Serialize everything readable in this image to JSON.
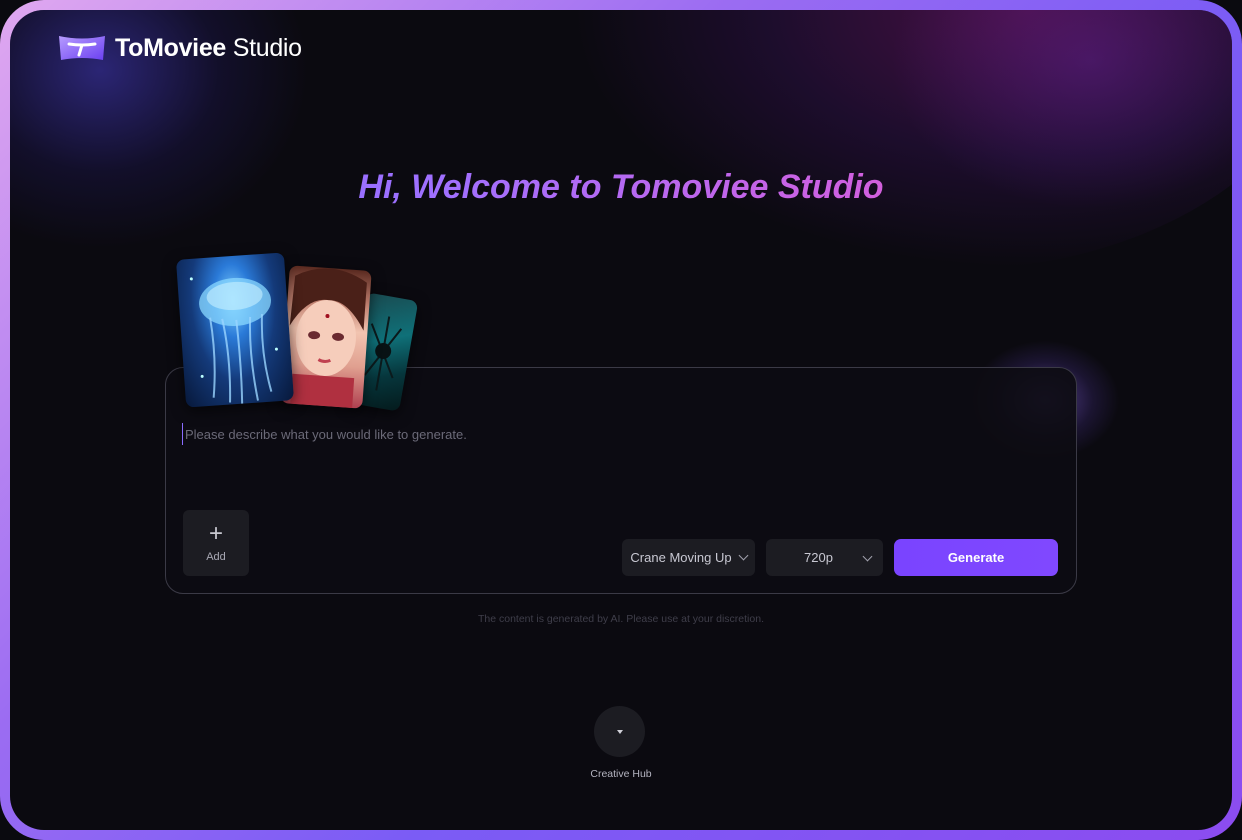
{
  "brand": {
    "name_bold": "ToMoviee",
    "name_light": "Studio",
    "logo_icon": "tomoviee-logo-icon"
  },
  "welcome": {
    "title": "Hi, Welcome to Tomoviee Studio"
  },
  "prompt": {
    "placeholder": "Please describe what you would like to generate.",
    "value": ""
  },
  "add": {
    "icon": "plus-icon",
    "label": "Add"
  },
  "camera_select": {
    "value": "Crane Moving Up"
  },
  "resolution_select": {
    "value": "720p"
  },
  "generate": {
    "label": "Generate"
  },
  "disclaimer": "The content is generated by AI. Please use at your discretion.",
  "hub": {
    "icon": "caret-down-icon",
    "label": "Creative Hub"
  },
  "colors": {
    "accent": "#7a44ff",
    "background": "#0b0a10",
    "frame_gradient_start": "#e0a8f0",
    "frame_gradient_end": "#8c4cf0"
  }
}
